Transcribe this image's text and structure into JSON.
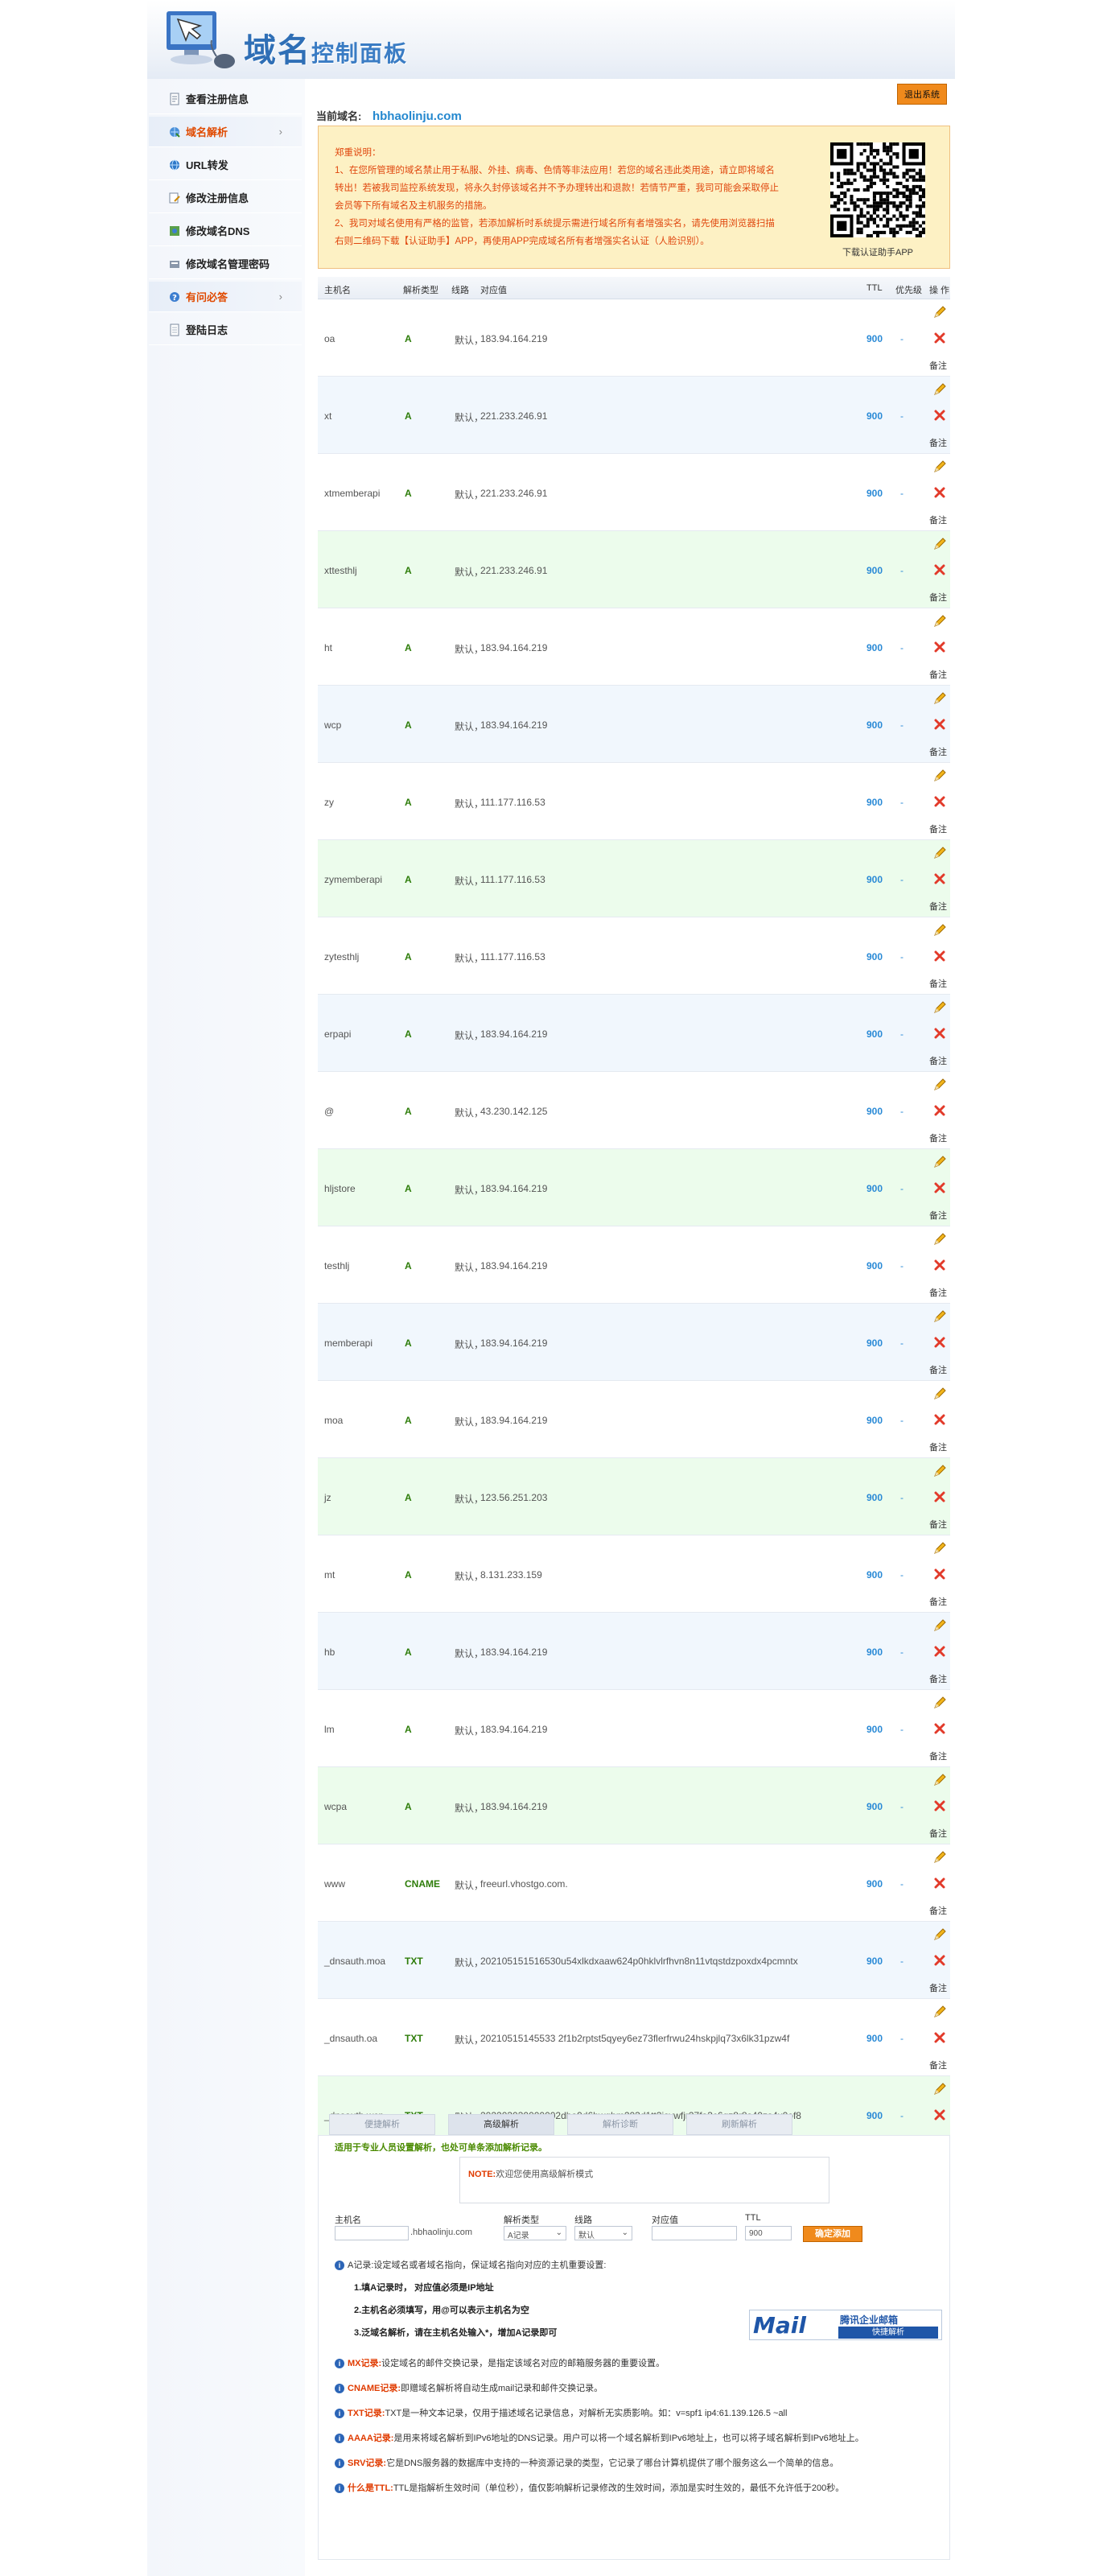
{
  "header": {
    "logo_text": "域名控制面板",
    "logo_big": "域名",
    "logo_small": "控制面板"
  },
  "sidebar": {
    "items": [
      {
        "label": "查看注册信息",
        "icon": "document-icon",
        "active": false,
        "chevron": false
      },
      {
        "label": "域名解析",
        "icon": "globe-arrow-icon",
        "active": true,
        "chevron": true
      },
      {
        "label": "URL转发",
        "icon": "globe-icon",
        "active": false,
        "chevron": false
      },
      {
        "label": "修改注册信息",
        "icon": "edit-document-icon",
        "active": false,
        "chevron": false
      },
      {
        "label": "修改域名DNS",
        "icon": "dns-icon",
        "active": false,
        "chevron": false
      },
      {
        "label": "修改域名管理密码",
        "icon": "key-icon",
        "active": false,
        "chevron": false
      },
      {
        "label": "有问必答",
        "icon": "help-icon",
        "active": true,
        "chevron": true
      },
      {
        "label": "登陆日志",
        "icon": "log-icon",
        "active": false,
        "chevron": false
      }
    ]
  },
  "logout_label": "退出系统",
  "current_domain": {
    "label": "当前域名:",
    "value": "hbhaolinju.com"
  },
  "notice": {
    "title": "郑重说明：",
    "lines": [
      "1、在您所管理的域名禁止用于私服、外挂、病毒、色情等非法应用！若您的域名违此类用途，请立即将域名",
      "转出！若被我司监控系统发现，将永久封停该域名并不予办理转出和退款！若情节严重，我司可能会采取停止",
      "会员等下所有域名及主机服务的措施。",
      "2、我司对域名使用有严格的监管，若添加解析时系统提示需进行域名所有者增强实名，请先使用浏览器扫描",
      "右则二维码下载【认证助手】APP，再使用APP完成域名所有者增强实名认证（人脸识别）。"
    ],
    "qr_caption": "下载认证助手APP"
  },
  "table": {
    "headers": {
      "host": "主机名",
      "type": "解析类型",
      "line": "线路",
      "value": "对应值",
      "ttl": "TTL",
      "priority": "优先级",
      "op": "操 作"
    },
    "edit_icon": "pencil-icon",
    "delete_icon": "red-x-icon",
    "note_label": "备注",
    "rows": [
      {
        "host": "oa",
        "type": "A",
        "line": "默认",
        "value": "183.94.164.219",
        "ttl": "900",
        "priority": "-"
      },
      {
        "host": "xt",
        "type": "A",
        "line": "默认",
        "value": "221.233.246.91",
        "ttl": "900",
        "priority": "-"
      },
      {
        "host": "xtmemberapi",
        "type": "A",
        "line": "默认",
        "value": "221.233.246.91",
        "ttl": "900",
        "priority": "-"
      },
      {
        "host": "xttesthlj",
        "type": "A",
        "line": "默认",
        "value": "221.233.246.91",
        "ttl": "900",
        "priority": "-"
      },
      {
        "host": "ht",
        "type": "A",
        "line": "默认",
        "value": "183.94.164.219",
        "ttl": "900",
        "priority": "-"
      },
      {
        "host": "wcp",
        "type": "A",
        "line": "默认",
        "value": "183.94.164.219",
        "ttl": "900",
        "priority": "-"
      },
      {
        "host": "zy",
        "type": "A",
        "line": "默认",
        "value": "111.177.116.53",
        "ttl": "900",
        "priority": "-"
      },
      {
        "host": "zymemberapi",
        "type": "A",
        "line": "默认",
        "value": "111.177.116.53",
        "ttl": "900",
        "priority": "-"
      },
      {
        "host": "zytesthlj",
        "type": "A",
        "line": "默认",
        "value": "111.177.116.53",
        "ttl": "900",
        "priority": "-"
      },
      {
        "host": "erpapi",
        "type": "A",
        "line": "默认",
        "value": "183.94.164.219",
        "ttl": "900",
        "priority": "-"
      },
      {
        "host": "@",
        "type": "A",
        "line": "默认",
        "value": "43.230.142.125",
        "ttl": "900",
        "priority": "-"
      },
      {
        "host": "hljstore",
        "type": "A",
        "line": "默认",
        "value": "183.94.164.219",
        "ttl": "900",
        "priority": "-"
      },
      {
        "host": "testhlj",
        "type": "A",
        "line": "默认",
        "value": "183.94.164.219",
        "ttl": "900",
        "priority": "-"
      },
      {
        "host": "memberapi",
        "type": "A",
        "line": "默认",
        "value": "183.94.164.219",
        "ttl": "900",
        "priority": "-"
      },
      {
        "host": "moa",
        "type": "A",
        "line": "默认",
        "value": "183.94.164.219",
        "ttl": "900",
        "priority": "-"
      },
      {
        "host": "jz",
        "type": "A",
        "line": "默认",
        "value": "123.56.251.203",
        "ttl": "900",
        "priority": "-"
      },
      {
        "host": "mt",
        "type": "A",
        "line": "默认",
        "value": "8.131.233.159",
        "ttl": "900",
        "priority": "-"
      },
      {
        "host": "hb",
        "type": "A",
        "line": "默认",
        "value": "183.94.164.219",
        "ttl": "900",
        "priority": "-"
      },
      {
        "host": "lm",
        "type": "A",
        "line": "默认",
        "value": "183.94.164.219",
        "ttl": "900",
        "priority": "-"
      },
      {
        "host": "wcpa",
        "type": "A",
        "line": "默认",
        "value": "183.94.164.219",
        "ttl": "900",
        "priority": "-"
      },
      {
        "host": "www",
        "type": "CNAME",
        "line": "默认",
        "value": "freeurl.vhostgo.com.",
        "ttl": "900",
        "priority": "-"
      },
      {
        "host": "_dnsauth.moa",
        "type": "TXT",
        "line": "默认",
        "value": "202105151516530u54xlkdxaaw624p0hklvlrfhvn8n11vtqstdzpoxdx4pcmntx",
        "ttl": "900",
        "priority": "-"
      },
      {
        "host": "_dnsauth.oa",
        "type": "TXT",
        "line": "默认",
        "value": "20210515145533 2f1b2rptst5qyey6ez73flerfrwu24hskpjlq73x6lk31pzw4f",
        "ttl": "900",
        "priority": "-"
      },
      {
        "host": "_dnsauth.wcp",
        "type": "TXT",
        "line": "默认",
        "value": "202203030000002dba9d6hwghm203d1tt3isvwfjr27fa3c6qz8r8s40zs4x0of8",
        "ttl": "900",
        "priority": "-"
      }
    ]
  },
  "tabs": [
    "便捷解析",
    "高级解析",
    "解析诊断",
    "刷新解析"
  ],
  "advanced": {
    "hint": "适用于专业人员设置解析，也处可单条添加解析记录。",
    "note_label": "NOTE:",
    "note_text": "欢迎您使用高级解析模式",
    "form": {
      "host_label": "主机名",
      "host_value": "",
      "suffix": ".hbhaolinju.com",
      "type_label": "解析类型",
      "type_value": "A记录",
      "line_label": "线路",
      "line_value": "默认",
      "value_label": "对应值",
      "value_value": "",
      "ttl_label": "TTL",
      "ttl_value": "900",
      "add_label": "确定添加"
    },
    "a_desc": "A记录:设定域名或者域名指向，保证域名指向对应的主机重要设置:",
    "a_rules": [
      "1.填A记录时， 对应值必须是IP地址",
      "2.主机名必须填写，用@可以表示主机名为空",
      "3.泛域名解析，请在主机名处输入*，增加A记录即可"
    ],
    "mail_banner": {
      "left": "Mail",
      "right_top": "腾讯企业邮箱",
      "right_bottom": "快捷解析"
    },
    "infos": [
      {
        "k": "MX记录:",
        "t": "设定域名的邮件交换记录，是指定该域名对应的邮箱服务器的重要设置。"
      },
      {
        "k": "CNAME记录:",
        "t": "即赠域名解析将自动生成mail记录和邮件交换记录。"
      },
      {
        "k": "TXT记录:",
        "t": "TXT是一种文本记录，仅用于描述域名记录信息，对解析无实质影响。如：v=spf1 ip4:61.139.126.5 ~all"
      },
      {
        "k": "AAAA记录:",
        "t": "是用来将域名解析到IPv6地址的DNS记录。用户可以将一个域名解析到IPv6地址上，也可以将子域名解析到IPv6地址上。"
      },
      {
        "k": "SRV记录:",
        "t": "它是DNS服务器的数据库中支持的一种资源记录的类型，它记录了哪台计算机提供了哪个服务这么一个简单的信息。"
      },
      {
        "k": "什么是TTL:",
        "t": "TTL是指解析生效时间（单位秒），值仅影响解析记录修改的生效时间，添加是实时生效的，最低不允许低于200秒。"
      }
    ]
  }
}
